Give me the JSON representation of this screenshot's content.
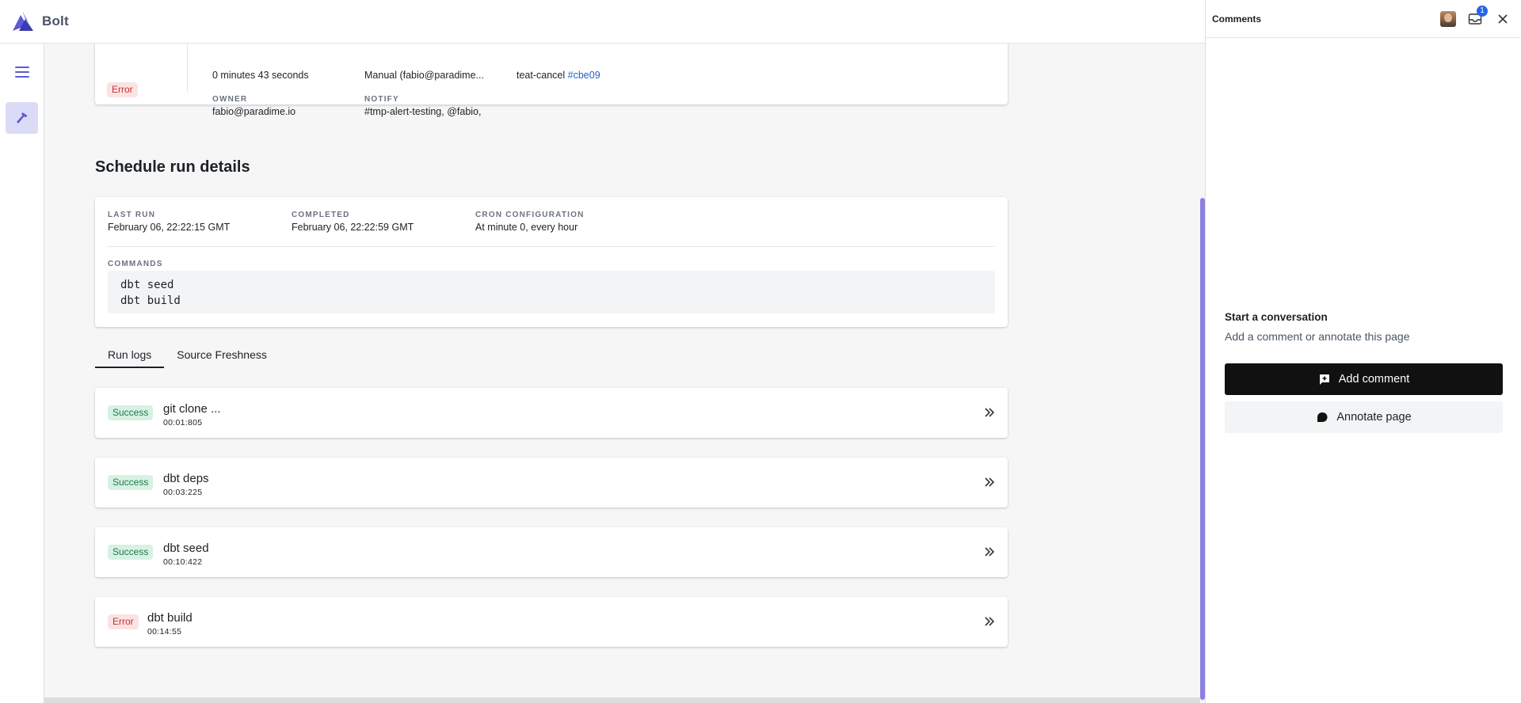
{
  "app": {
    "name": "Bolt",
    "logo_icon": "bolt-logo-icon",
    "accent": "#5b5bd6"
  },
  "nav": {
    "menu_icon": "hamburger-icon",
    "active_tool_icon": "hammer-icon"
  },
  "run_summary": {
    "status": "Error",
    "duration": "0 minutes 43 seconds",
    "trigger": "Manual (fabio@paradime...",
    "branch_text": "teat-cancel",
    "commit": "#cbe09",
    "owner_label": "OWNER",
    "owner": "fabio@paradime.io",
    "notify_label": "NOTIFY",
    "notify": "#tmp-alert-testing, @fabio,"
  },
  "schedule": {
    "title": "Schedule run details",
    "last_run_label": "LAST RUN",
    "last_run": "February 06, 22:22:15 GMT",
    "completed_label": "COMPLETED",
    "completed": "February 06, 22:22:59 GMT",
    "cron_label": "CRON CONFIGURATION",
    "cron": "At minute 0, every hour",
    "commands_label": "COMMANDS",
    "commands": [
      "dbt seed",
      "dbt build"
    ]
  },
  "tabs": [
    {
      "label": "Run logs",
      "active": true
    },
    {
      "label": "Source Freshness",
      "active": false
    }
  ],
  "logs": [
    {
      "status": "Success",
      "name": "git clone ...",
      "time": "00:01:805"
    },
    {
      "status": "Success",
      "name": "dbt deps",
      "time": "00:03:225"
    },
    {
      "status": "Success",
      "name": "dbt seed",
      "time": "00:10:422"
    },
    {
      "status": "Error",
      "name": "dbt build",
      "time": "00:14:55"
    }
  ],
  "comments": {
    "title": "Comments",
    "inbox_count": "1",
    "empty_title": "Start a conversation",
    "empty_subtitle": "Add a comment or annotate this page",
    "add_label": "Add comment",
    "annotate_label": "Annotate page"
  }
}
